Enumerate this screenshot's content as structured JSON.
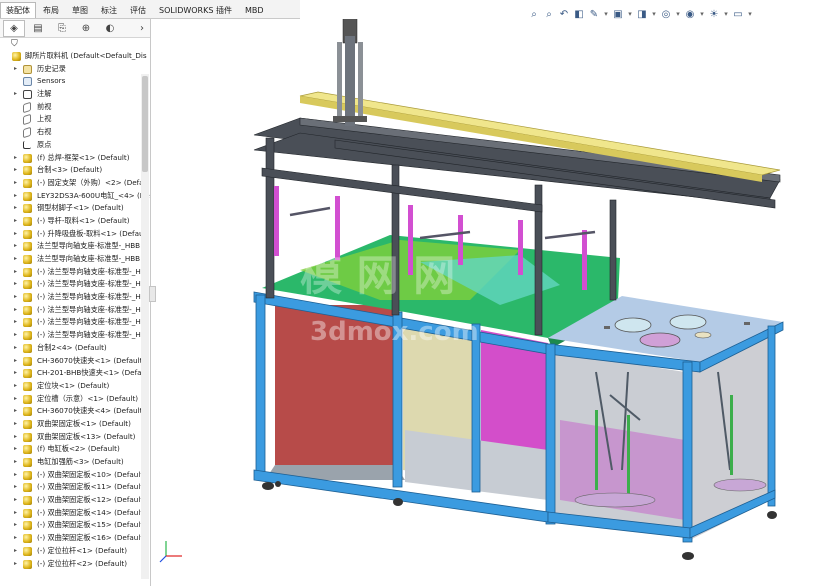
{
  "command_tabs": [
    "装配体",
    "布局",
    "草图",
    "标注",
    "评估",
    "SOLIDWORKS 插件",
    "MBD"
  ],
  "active_tab_index": 0,
  "view_toolbar_icons": [
    "zoom-to-fit-icon",
    "zoom-area-icon",
    "previous-view-icon",
    "section-view-icon",
    "dynamic-annotation-icon",
    "view-orientation-icon",
    "display-style-icon",
    "hide-show-icon",
    "edit-appearance-icon",
    "apply-scene-icon",
    "view-settings-icon"
  ],
  "panel_tabs": [
    "feature-manager-icon",
    "property-manager-icon",
    "configuration-manager-icon",
    "dimxpert-icon",
    "display-manager-icon",
    "expand-arrow-icon"
  ],
  "tree": {
    "root": "脚所片取料机 (Default<Default_Dis",
    "items": [
      {
        "icon": "folder",
        "label": "历史记录",
        "exp": "▸"
      },
      {
        "icon": "sensor",
        "label": "Sensors",
        "exp": ""
      },
      {
        "icon": "note",
        "label": "注解",
        "exp": "▸"
      },
      {
        "icon": "plane",
        "label": "前视",
        "exp": ""
      },
      {
        "icon": "plane",
        "label": "上视",
        "exp": ""
      },
      {
        "icon": "plane",
        "label": "右视",
        "exp": ""
      },
      {
        "icon": "origin",
        "label": "原点",
        "exp": ""
      },
      {
        "icon": "part",
        "label": "(f) 总焊-框架<1> (Default)",
        "exp": "▸"
      },
      {
        "icon": "part",
        "label": "台制<3> (Default)",
        "exp": "▸"
      },
      {
        "icon": "part",
        "label": "(-) 固定支架（外购）<2> (Defa",
        "exp": "▸"
      },
      {
        "icon": "part",
        "label": "LEY32DS3A-600U电缸_<4> (De",
        "exp": "▸"
      },
      {
        "icon": "part",
        "label": "钢型材脚子<1> (Default)",
        "exp": "▸"
      },
      {
        "icon": "part",
        "label": "(-) 导杆-取料<1> (Default)",
        "exp": "▸"
      },
      {
        "icon": "part",
        "label": "(-) 升降吸盘板-取料<1> (Defau",
        "exp": "▸"
      },
      {
        "icon": "part",
        "label": "法兰型导向轴支座-标准型-_HBB",
        "exp": "▸"
      },
      {
        "icon": "part",
        "label": "法兰型导向轴支座-标准型-_HBB",
        "exp": "▸"
      },
      {
        "icon": "part",
        "label": "(-) 法兰型导向轴支座-标准型-_H",
        "exp": "▸"
      },
      {
        "icon": "part",
        "label": "(-) 法兰型导向轴支座-标准型-_H",
        "exp": "▸"
      },
      {
        "icon": "part",
        "label": "(-) 法兰型导向轴支座-标准型-_H",
        "exp": "▸"
      },
      {
        "icon": "part",
        "label": "(-) 法兰型导向轴支座-标准型-_H",
        "exp": "▸"
      },
      {
        "icon": "part",
        "label": "(-) 法兰型导向轴支座-标准型-_H",
        "exp": "▸"
      },
      {
        "icon": "part",
        "label": "(-) 法兰型导向轴支座-标准型-_H",
        "exp": "▸"
      },
      {
        "icon": "part",
        "label": "台制2<4> (Default)",
        "exp": "▸"
      },
      {
        "icon": "part",
        "label": "CH-36070快速夹<1> (Default)",
        "exp": "▸"
      },
      {
        "icon": "part",
        "label": "CH-201-BHB快速夹<1> (Defau",
        "exp": "▸"
      },
      {
        "icon": "part",
        "label": "定位块<1> (Default)",
        "exp": "▸"
      },
      {
        "icon": "part",
        "label": "定位槽（示意）<1> (Default)",
        "exp": "▸"
      },
      {
        "icon": "part",
        "label": "CH-36070快速夹<4> (Default)",
        "exp": "▸"
      },
      {
        "icon": "part",
        "label": "双曲架固定板<1> (Default)",
        "exp": "▸"
      },
      {
        "icon": "part",
        "label": "双曲架固定板<13> (Default)",
        "exp": "▸"
      },
      {
        "icon": "part",
        "label": "(f) 电缸板<2> (Default)",
        "exp": "▸"
      },
      {
        "icon": "part",
        "label": "电缸加强筋<3> (Default)",
        "exp": "▸"
      },
      {
        "icon": "part",
        "label": "(-) 双曲架固定板<10> (Default)",
        "exp": "▸"
      },
      {
        "icon": "part",
        "label": "(-) 双曲架固定板<11> (Default)",
        "exp": "▸"
      },
      {
        "icon": "part",
        "label": "(-) 双曲架固定板<12> (Default)",
        "exp": "▸"
      },
      {
        "icon": "part",
        "label": "(-) 双曲架固定板<14> (Default)",
        "exp": "▸"
      },
      {
        "icon": "part",
        "label": "(-) 双曲架固定板<15> (Default)",
        "exp": "▸"
      },
      {
        "icon": "part",
        "label": "(-) 双曲架固定板<16> (Default)",
        "exp": "▸"
      },
      {
        "icon": "part",
        "label": "(-) 定位拉杆<1> (Default)",
        "exp": "▸"
      },
      {
        "icon": "part",
        "label": "(-) 定位拉杆<2> (Default)",
        "exp": "▸"
      }
    ]
  },
  "watermark": "3dmox.com",
  "watermark_cn": "模 网 网"
}
